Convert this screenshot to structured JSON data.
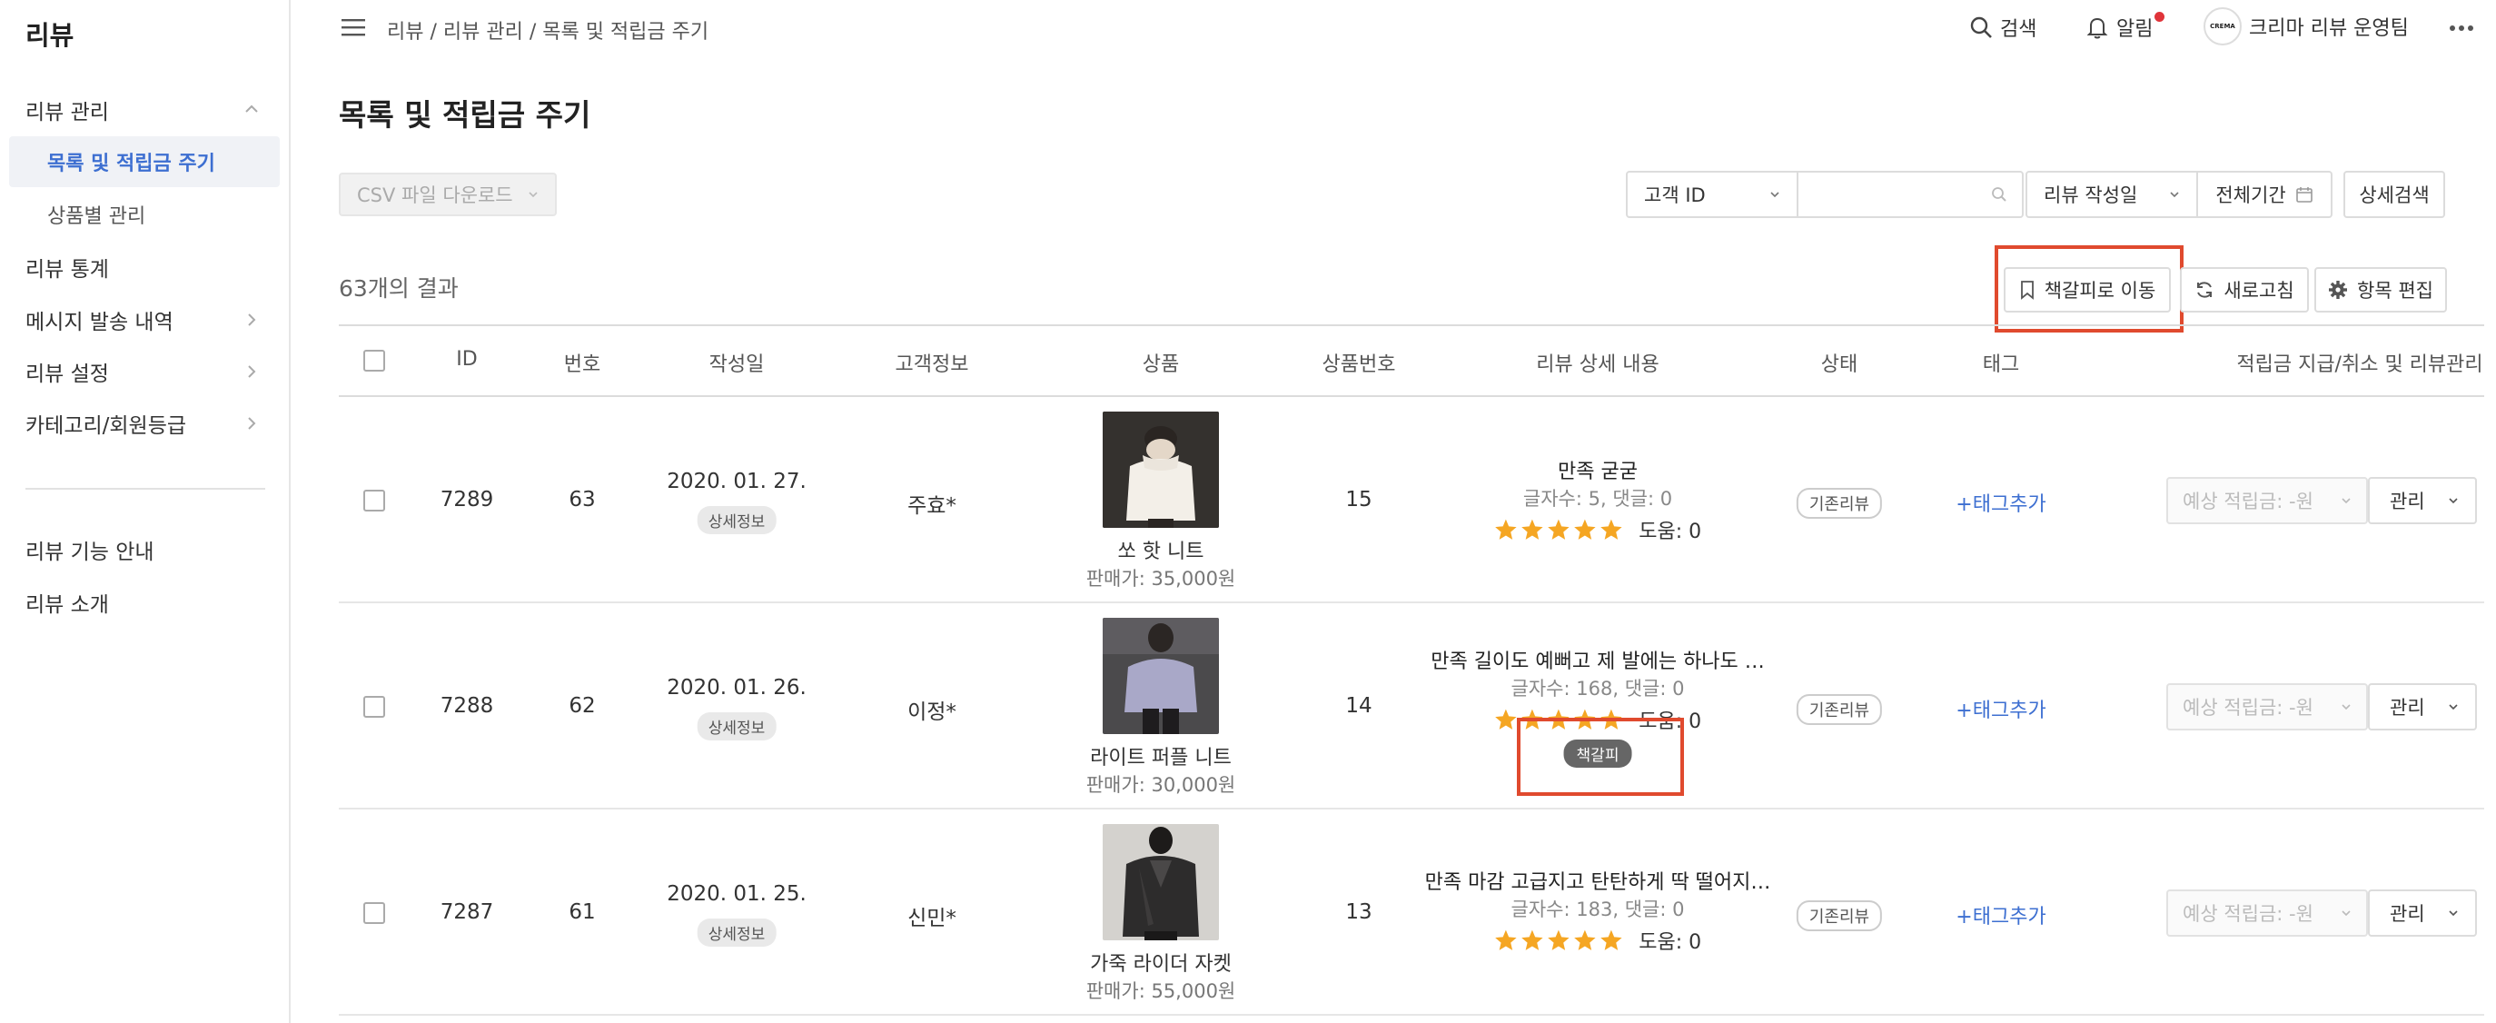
{
  "sidebar": {
    "title": "리뷰",
    "items": [
      {
        "label": "리뷰 관리"
      },
      {
        "label": "목록 및 적립금 주기"
      },
      {
        "label": "상품별 관리"
      },
      {
        "label": "리뷰 통계"
      },
      {
        "label": "메시지 발송 내역"
      },
      {
        "label": "리뷰 설정"
      },
      {
        "label": "카테고리/회원등급"
      },
      {
        "label": "리뷰 기능 안내"
      },
      {
        "label": "리뷰 소개"
      }
    ]
  },
  "topbar": {
    "breadcrumb": "리뷰 / 리뷰 관리 / 목록 및 적립금 주기",
    "search_label": "검색",
    "notifications_label": "알림",
    "account_label": "크리마 리뷰 운영팀",
    "avatar_text": "CREMA"
  },
  "page": {
    "title": "목록 및 적립금 주기",
    "csv_label": "CSV 파일 다운로드",
    "filter_field": "고객 ID",
    "search_value": "",
    "date_field": "리뷰 작성일",
    "period_label": "전체기간",
    "detail_search_label": "상세검색",
    "result_count": "63개의 결과",
    "bookmark_move_label": "책갈피로 이동",
    "refresh_label": "새로고침",
    "edit_columns_label": "항목 편집"
  },
  "table": {
    "headers": [
      "ID",
      "번호",
      "작성일",
      "고객정보",
      "상품",
      "상품번호",
      "리뷰 상세 내용",
      "상태",
      "태그",
      "적립금 지급/취소 및 리뷰관리"
    ],
    "rows": [
      {
        "id": "7289",
        "no": "63",
        "date": "2020. 01. 27.",
        "detail_chip": "상세정보",
        "customer": "주효*",
        "product_name": "쏘 핫 니트",
        "product_price": "판매가: 35,000원",
        "product_no": "15",
        "review_title": "만족 굳굳",
        "review_meta": "글자수: 5, 댓글: 0",
        "rating": 5,
        "help": "도움: 0",
        "bookmark_chip": "",
        "status": "기존리뷰",
        "tag": "+태그추가",
        "reward": "예상 적립금: -원",
        "manage": "관리"
      },
      {
        "id": "7288",
        "no": "62",
        "date": "2020. 01. 26.",
        "detail_chip": "상세정보",
        "customer": "이정*",
        "product_name": "라이트 퍼플 니트",
        "product_price": "판매가: 30,000원",
        "product_no": "14",
        "review_title": "만족 길이도 예뻐고 제 발에는 하나도 …",
        "review_meta": "글자수: 168, 댓글: 0",
        "rating": 5,
        "help": "도움: 0",
        "bookmark_chip": "책갈피",
        "status": "기존리뷰",
        "tag": "+태그추가",
        "reward": "예상 적립금: -원",
        "manage": "관리"
      },
      {
        "id": "7287",
        "no": "61",
        "date": "2020. 01. 25.",
        "detail_chip": "상세정보",
        "customer": "신민*",
        "product_name": "가죽 라이더 자켓",
        "product_price": "판매가: 55,000원",
        "product_no": "13",
        "review_title": "만족 마감 고급지고 탄탄하게 딱 떨어지…",
        "review_meta": "글자수: 183, 댓글: 0",
        "rating": 5,
        "help": "도움: 0",
        "bookmark_chip": "",
        "status": "기존리뷰",
        "tag": "+태그추가",
        "reward": "예상 적립금: -원",
        "manage": "관리"
      }
    ]
  },
  "colors": {
    "accent": "#3d6fd1",
    "highlight": "#e04a2e",
    "star": "#f5a623",
    "notification_dot": "#e0343a"
  }
}
